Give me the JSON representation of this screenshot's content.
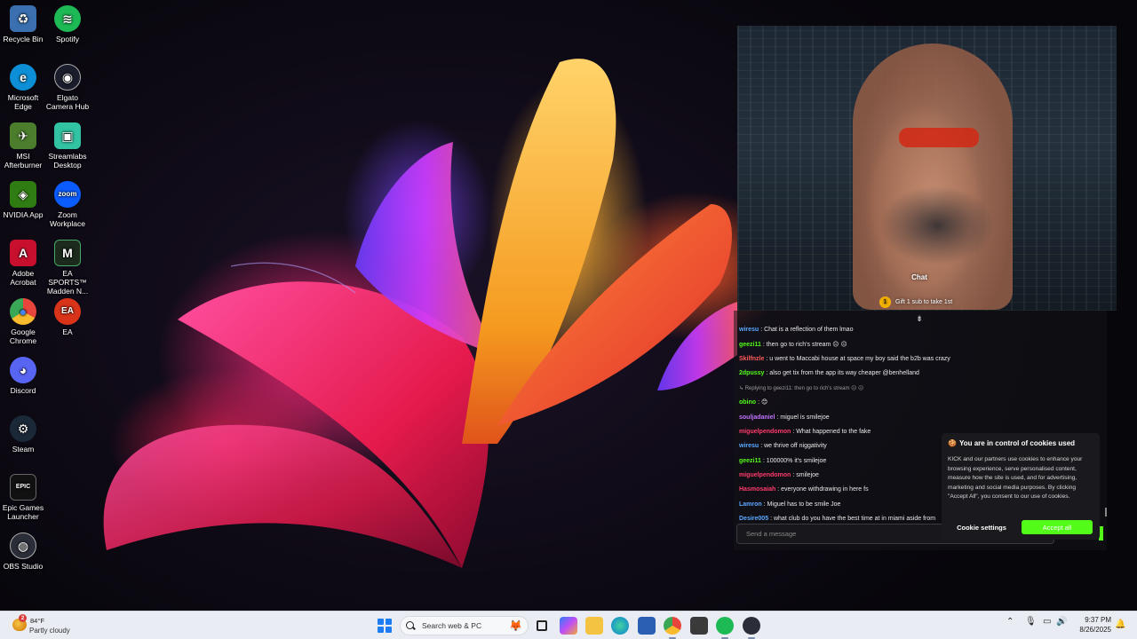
{
  "desktop": {
    "icons": [
      {
        "label": "Recycle Bin",
        "icon": "recycle-bin-icon",
        "color": "#3a6fb0",
        "glyph": "♻"
      },
      {
        "label": "Spotify",
        "icon": "spotify-icon",
        "color": "#1db954",
        "glyph": "≋"
      },
      {
        "label": "Microsoft Edge",
        "icon": "edge-icon",
        "color": "#0c8fd6",
        "glyph": "e"
      },
      {
        "label": "Elgato Camera Hub",
        "icon": "elgato-camera-hub-icon",
        "color": "#1a1d2b",
        "glyph": "◉"
      },
      {
        "label": "MSI Afterburner",
        "icon": "msi-afterburner-icon",
        "color": "#4b7d2c",
        "glyph": "✈"
      },
      {
        "label": "Streamlabs Desktop",
        "icon": "streamlabs-icon",
        "color": "#31c3a2",
        "glyph": "▣"
      },
      {
        "label": "NVIDIA App",
        "icon": "nvidia-icon",
        "color": "#2f7d12",
        "glyph": "◈"
      },
      {
        "label": "Zoom Workplace",
        "icon": "zoom-icon",
        "color": "#0b5cff",
        "glyph": "zoom"
      },
      {
        "label": "Adobe Acrobat",
        "icon": "adobe-acrobat-icon",
        "color": "#c8102e",
        "glyph": "A"
      },
      {
        "label": "EA SPORTS™ Madden N...",
        "icon": "madden-icon",
        "color": "#1c2a1c",
        "glyph": "M"
      },
      {
        "label": "Google Chrome",
        "icon": "chrome-icon",
        "color": "#e8453c",
        "glyph": "●"
      },
      {
        "label": "EA",
        "icon": "ea-icon",
        "color": "#d9341a",
        "glyph": "EA"
      },
      {
        "label": "Discord",
        "icon": "discord-icon",
        "color": "#5865f2",
        "glyph": "◕"
      },
      {
        "label": "Steam",
        "icon": "steam-icon",
        "color": "#1b2838",
        "glyph": "⚙"
      },
      {
        "label": "Epic Games Launcher",
        "icon": "epic-games-icon",
        "color": "#111111",
        "glyph": "EPIC"
      },
      {
        "label": "OBS Studio",
        "icon": "obs-studio-icon",
        "color": "#2b2e38",
        "glyph": "◍"
      }
    ]
  },
  "stream": {
    "overlay_chat_label": "Chat",
    "gift_badge": "1",
    "gift_text": "Gift 1 sub to take 1st",
    "chat_messages": [
      {
        "user": "wiresu",
        "text": ": Chat is a reflection of them lmao",
        "color": "#5ba8ff",
        "type": "msg"
      },
      {
        "user": "geezi11",
        "text": ": then go to rich's stream 😐 😐",
        "color": "#53fc18",
        "type": "msg"
      },
      {
        "user": "Skilfnzle",
        "text": ": u went to Maccabi house at space my boy said the b2b was crazy",
        "color": "#ff5b5b",
        "type": "msg"
      },
      {
        "user": "2dpussy",
        "text": ": also get tix from the app its way cheaper @benhelland",
        "color": "#53fc18",
        "type": "msg"
      },
      {
        "user": "",
        "text": "↳ Replying to geezi11: then go to rich's stream 😐 😐",
        "color": "#9a9a9a",
        "type": "reply"
      },
      {
        "user": "obino",
        "text": ": 😊",
        "color": "#53fc18",
        "type": "msg"
      },
      {
        "user": "souljadaniel",
        "text": ": miguel is smilejoe",
        "color": "#c074ff",
        "type": "msg"
      },
      {
        "user": "miguelpendomon",
        "text": ": What happened to the fake",
        "color": "#ff3b6b",
        "type": "msg"
      },
      {
        "user": "wiresu",
        "text": ": we thrive off niggativity",
        "color": "#5ba8ff",
        "type": "msg"
      },
      {
        "user": "geezi11",
        "text": ": 100000% it's smilejoe",
        "color": "#53fc18",
        "type": "msg"
      },
      {
        "user": "miguelpendomon",
        "text": ": smilejoe",
        "color": "#ff3b6b",
        "type": "msg"
      },
      {
        "user": "Hasmosaiah",
        "text": ": everyone withdrawing in here fs",
        "color": "#ff3b6b",
        "type": "msg"
      },
      {
        "user": "Lamron",
        "text": ": Miguel has to be smile Joe",
        "color": "#5ba8ff",
        "type": "msg"
      },
      {
        "user": "Desire005",
        "text": ": what club do you have the best time at in miami aside from",
        "color": "#5ba8ff",
        "type": "msg"
      }
    ],
    "chat_input_placeholder": "Send a message"
  },
  "cookie_banner": {
    "title": "You are in control of cookies used",
    "body": "KICK and our partners use cookies to enhance your browsing experience, serve personalised content, measure how the site is used, and for advertising, marketing and social media purposes. By clicking \"Accept All\", you consent to our use of cookies.",
    "settings_label": "Cookie settings",
    "accept_label": "Accept all",
    "accent": "#53fc18"
  },
  "taskbar": {
    "weather_temp": "84°F",
    "weather_badge": "2",
    "weather_condition": "Partly cloudy",
    "search_placeholder": "Search web & PC",
    "time": "9:37 PM",
    "date": "8/26/2025"
  }
}
